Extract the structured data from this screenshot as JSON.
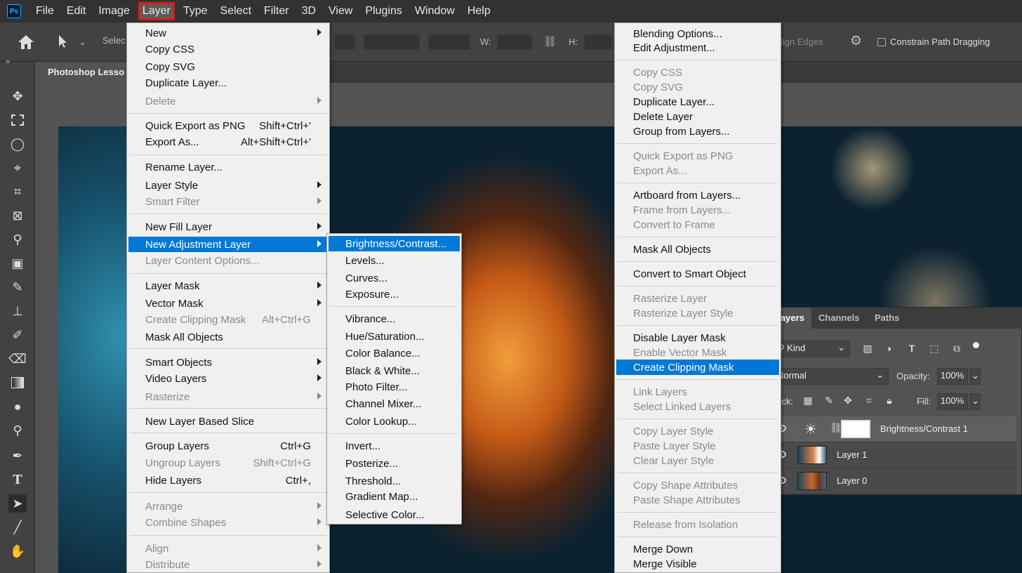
{
  "menubar": {
    "logo": "Ps",
    "items": [
      "File",
      "Edit",
      "Image",
      "Layer",
      "Type",
      "Select",
      "Filter",
      "3D",
      "View",
      "Plugins",
      "Window",
      "Help"
    ]
  },
  "options": {
    "select_partial": "Selec",
    "w_label": "W:",
    "h_label": "H:",
    "align_edges_partial": "lign Edges",
    "constrain_label": "Constrain Path Dragging"
  },
  "document": {
    "tab_title": "Photoshop Lesso"
  },
  "layer_menu": [
    {
      "label": "New",
      "submenu": true
    },
    {
      "label": "Copy CSS"
    },
    {
      "label": "Copy SVG"
    },
    {
      "label": "Duplicate Layer..."
    },
    {
      "label": "Delete",
      "disabled": true,
      "submenu": true
    },
    {
      "label": "Quick Export as PNG",
      "shortcut": "Shift+Ctrl+'"
    },
    {
      "label": "Export As...",
      "shortcut": "Alt+Shift+Ctrl+'"
    },
    {
      "label": "Rename Layer..."
    },
    {
      "label": "Layer Style",
      "submenu": true
    },
    {
      "label": "Smart Filter",
      "disabled": true,
      "submenu": true
    },
    {
      "label": "New Fill Layer",
      "submenu": true
    },
    {
      "label": "New Adjustment Layer",
      "submenu": true,
      "highlighted": true
    },
    {
      "label": "Layer Content Options...",
      "disabled": true
    },
    {
      "label": "Layer Mask",
      "submenu": true
    },
    {
      "label": "Vector Mask",
      "submenu": true
    },
    {
      "label": "Create Clipping Mask",
      "shortcut": "Alt+Ctrl+G",
      "disabled": true
    },
    {
      "label": "Mask All Objects"
    },
    {
      "label": "Smart Objects",
      "submenu": true
    },
    {
      "label": "Video Layers",
      "submenu": true
    },
    {
      "label": "Rasterize",
      "disabled": true,
      "submenu": true
    },
    {
      "label": "New Layer Based Slice"
    },
    {
      "label": "Group Layers",
      "shortcut": "Ctrl+G"
    },
    {
      "label": "Ungroup Layers",
      "shortcut": "Shift+Ctrl+G",
      "disabled": true
    },
    {
      "label": "Hide Layers",
      "shortcut": "Ctrl+,"
    },
    {
      "label": "Arrange",
      "disabled": true,
      "submenu": true
    },
    {
      "label": "Combine Shapes",
      "disabled": true,
      "submenu": true
    },
    {
      "label": "Align",
      "disabled": true,
      "submenu": true
    },
    {
      "label": "Distribute",
      "disabled": true,
      "submenu": true
    }
  ],
  "adjustment_submenu": [
    {
      "label": "Brightness/Contrast...",
      "highlighted": true
    },
    {
      "label": "Levels..."
    },
    {
      "label": "Curves..."
    },
    {
      "label": "Exposure..."
    },
    {
      "label": "Vibrance..."
    },
    {
      "label": "Hue/Saturation..."
    },
    {
      "label": "Color Balance..."
    },
    {
      "label": "Black & White..."
    },
    {
      "label": "Photo Filter..."
    },
    {
      "label": "Channel Mixer..."
    },
    {
      "label": "Color Lookup..."
    },
    {
      "label": "Invert..."
    },
    {
      "label": "Posterize..."
    },
    {
      "label": "Threshold..."
    },
    {
      "label": "Gradient Map..."
    },
    {
      "label": "Selective Color..."
    }
  ],
  "context_menu": [
    {
      "label": "Blending Options..."
    },
    {
      "label": "Edit Adjustment..."
    },
    {
      "label": "Copy CSS",
      "disabled": true
    },
    {
      "label": "Copy SVG",
      "disabled": true
    },
    {
      "label": "Duplicate Layer..."
    },
    {
      "label": "Delete Layer"
    },
    {
      "label": "Group from Layers..."
    },
    {
      "label": "Quick Export as PNG",
      "disabled": true
    },
    {
      "label": "Export As...",
      "disabled": true
    },
    {
      "label": "Artboard from Layers..."
    },
    {
      "label": "Frame from Layers...",
      "disabled": true
    },
    {
      "label": "Convert to Frame",
      "disabled": true
    },
    {
      "label": "Mask All Objects"
    },
    {
      "label": "Convert to Smart Object"
    },
    {
      "label": "Rasterize Layer",
      "disabled": true
    },
    {
      "label": "Rasterize Layer Style",
      "disabled": true
    },
    {
      "label": "Disable Layer Mask"
    },
    {
      "label": "Enable Vector Mask",
      "disabled": true
    },
    {
      "label": "Create Clipping Mask",
      "highlighted": true
    },
    {
      "label": "Link Layers",
      "disabled": true
    },
    {
      "label": "Select Linked Layers",
      "disabled": true
    },
    {
      "label": "Copy Layer Style",
      "disabled": true
    },
    {
      "label": "Paste Layer Style",
      "disabled": true
    },
    {
      "label": "Clear Layer Style",
      "disabled": true
    },
    {
      "label": "Copy Shape Attributes",
      "disabled": true
    },
    {
      "label": "Paste Shape Attributes",
      "disabled": true
    },
    {
      "label": "Release from Isolation",
      "disabled": true
    },
    {
      "label": "Merge Down"
    },
    {
      "label": "Merge Visible"
    }
  ],
  "layers_panel": {
    "tabs": [
      "Layers",
      "Channels",
      "Paths"
    ],
    "filter_kind": "Kind",
    "blend_mode": "Normal",
    "opacity_label": "Opacity:",
    "opacity_value": "100%",
    "lock_label": "Lock:",
    "fill_label": "Fill:",
    "fill_value": "100%",
    "layers": [
      {
        "name": "Brightness/Contrast 1"
      },
      {
        "name": "Layer 1"
      },
      {
        "name": "Layer 0"
      }
    ]
  },
  "colors": {
    "accent_highlight": "#0078d7",
    "active_outline": "#e0191c"
  }
}
